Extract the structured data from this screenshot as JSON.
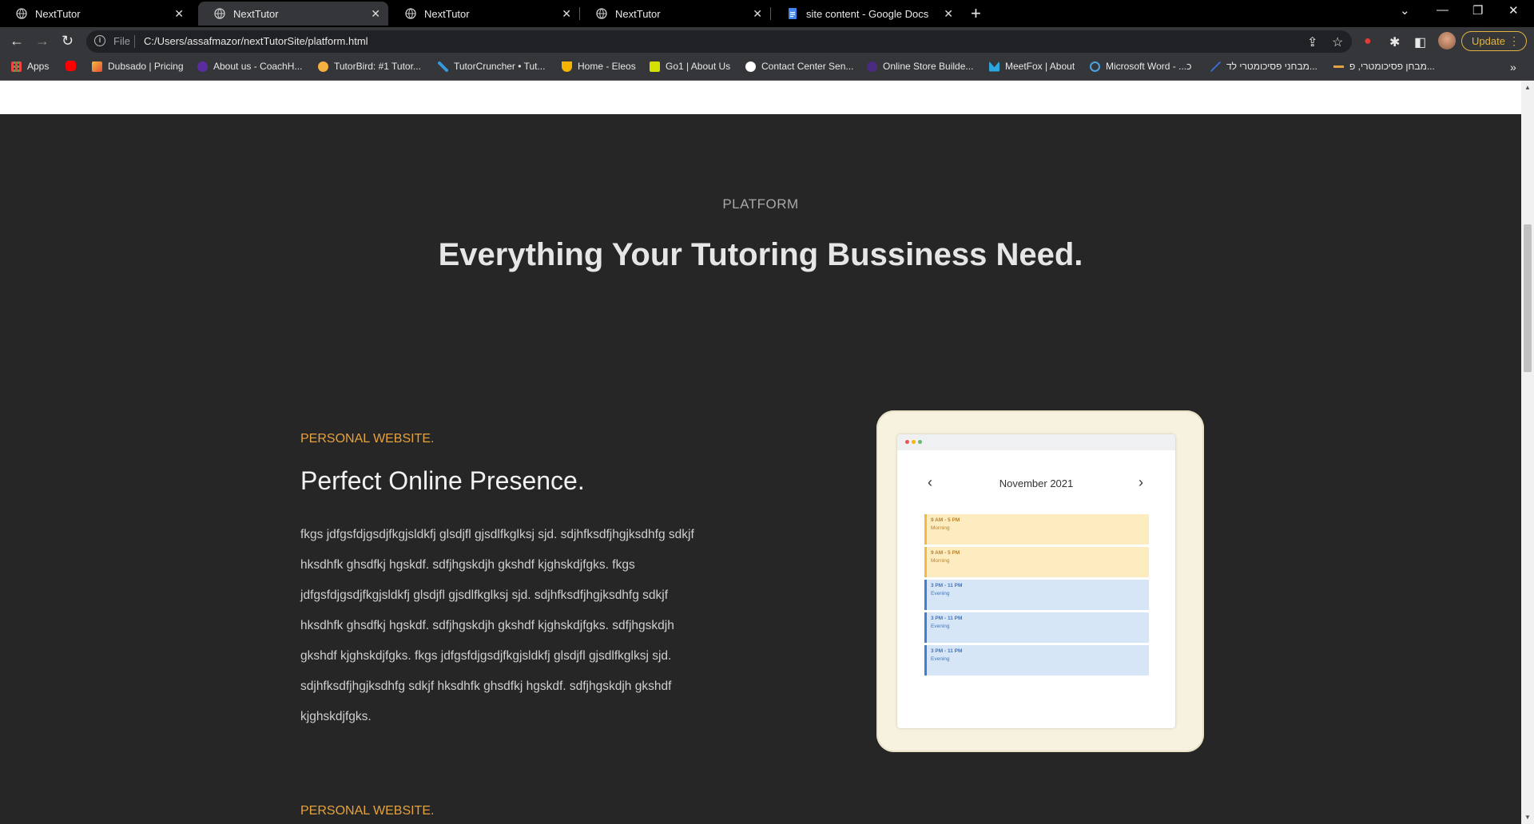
{
  "browser": {
    "tabs": [
      {
        "title": "NextTutor",
        "active": false,
        "icon": "globe-icon"
      },
      {
        "title": "NextTutor",
        "active": true,
        "icon": "globe-icon"
      },
      {
        "title": "NextTutor",
        "active": false,
        "icon": "globe-icon"
      },
      {
        "title": "NextTutor",
        "active": false,
        "icon": "globe-icon"
      },
      {
        "title": "site content - Google Docs",
        "active": false,
        "icon": "google-docs-icon"
      }
    ],
    "address": {
      "scheme": "File",
      "url": "C:/Users/assafmazor/nextTutorSite/platform.html"
    },
    "update_label": "Update",
    "bookmarks": [
      {
        "label": "Apps",
        "icon": "apps-grid-icon"
      },
      {
        "label": "",
        "icon": "youtube-icon"
      },
      {
        "label": "Dubsado | Pricing",
        "icon": "dubsado-icon"
      },
      {
        "label": "About us - CoachH...",
        "icon": "coachhub-icon"
      },
      {
        "label": "TutorBird: #1 Tutor...",
        "icon": "tutorbird-icon"
      },
      {
        "label": "TutorCruncher • Tut...",
        "icon": "tutorcruncher-icon"
      },
      {
        "label": "Home - Eleos",
        "icon": "eleos-icon"
      },
      {
        "label": "Go1 | About Us",
        "icon": "go1-icon"
      },
      {
        "label": "Contact Center Sen...",
        "icon": "contact-center-icon"
      },
      {
        "label": "Online Store Builde...",
        "icon": "store-builder-icon"
      },
      {
        "label": "MeetFox | About",
        "icon": "meetfox-icon"
      },
      {
        "label": "Microsoft Word - ...כ",
        "icon": "word-icon"
      },
      {
        "label": "מבחני פסיכומטרי לד...",
        "icon": "psychometric-icon"
      },
      {
        "label": "מבחן פסיכומטרי, פ...",
        "icon": "psychometric-2-icon"
      }
    ],
    "colors": {
      "tabbar": "#000000",
      "toolbar": "#35363a",
      "update_accent": "#e3b341"
    }
  },
  "page": {
    "kicker": "PLATFORM",
    "headline": "Everything Your Tutoring Bussiness Need.",
    "section": {
      "kicker": "PERSONAL WEBSITE.",
      "title": "Perfect Online Presence.",
      "body": "fkgs jdfgsfdjgsdjfkgjsldkfj glsdjfl gjsdlfkglksj sjd. sdjhfksdfjhgjksdhfg sdkjf hksdhfk ghsdfkj hgskdf. sdfjhgskdjh gkshdf kjghskdjfgks. fkgs jdfgsfdjgsdjfkgjsldkfj glsdjfl gjsdlfkglksj sjd. sdjhfksdfjhgjksdhfg sdkjf hksdhfk ghsdfkj hgskdf. sdfjhgskdjh gkshdf kjghskdjfgks. sdfjhgskdjh gkshdf kjghskdjfgks. fkgs jdfgsfdjgsdjfkgjsldkfj glsdjfl gjsdlfkglksj sjd. sdjhfksdfjhgjksdhfg sdkjf hksdhfk ghsdfkj hgskdf. sdfjhgskdjh gkshdf kjghskdjfgks."
    },
    "next_section_kicker": "PERSONAL WEBSITE.",
    "calendar": {
      "month": "November 2021",
      "slots": [
        {
          "time": "9 AM - 5 PM",
          "label": "Morning",
          "kind": "morning"
        },
        {
          "time": "9 AM - 5 PM",
          "label": "Morning",
          "kind": "morning"
        },
        {
          "time": "3 PM - 11 PM",
          "label": "Evening",
          "kind": "evening"
        },
        {
          "time": "3 PM - 11 PM",
          "label": "Evening",
          "kind": "evening"
        },
        {
          "time": "3 PM - 11 PM",
          "label": "Evening",
          "kind": "evening"
        }
      ]
    },
    "colors": {
      "background": "#262626",
      "accent": "#e6a23c",
      "heading": "#e6e6e6"
    }
  }
}
